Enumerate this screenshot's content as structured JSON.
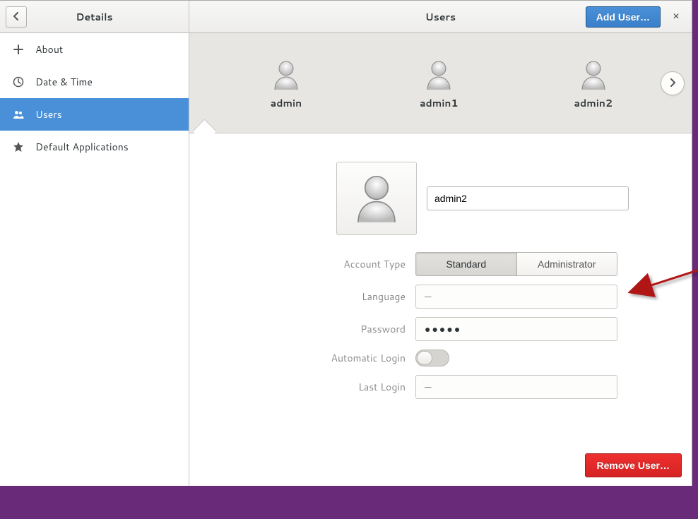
{
  "header": {
    "sidebar_title": "Details",
    "main_title": "Users",
    "add_user_label": "Add User…",
    "close_label": "×"
  },
  "sidebar": {
    "items": [
      {
        "label": "About",
        "icon": "plus-icon"
      },
      {
        "label": "Date & Time",
        "icon": "clock-icon"
      },
      {
        "label": "Users",
        "icon": "users-icon"
      },
      {
        "label": "Default Applications",
        "icon": "star-icon"
      }
    ],
    "selected_index": 2
  },
  "carousel": {
    "users": [
      {
        "name": "admin"
      },
      {
        "name": "admin1"
      },
      {
        "name": "admin2"
      }
    ],
    "selected_index": 2
  },
  "profile": {
    "name_value": "admin2",
    "labels": {
      "account_type": "Account Type",
      "language": "Language",
      "password": "Password",
      "automatic_login": "Automatic Login",
      "last_login": "Last Login"
    },
    "account_type": {
      "options": [
        "Standard",
        "Administrator"
      ],
      "active_index": 0
    },
    "language_value": "—",
    "password_value": "●●●●●",
    "automatic_login_on": false,
    "last_login_value": "—"
  },
  "footer": {
    "remove_user_label": "Remove User…"
  }
}
